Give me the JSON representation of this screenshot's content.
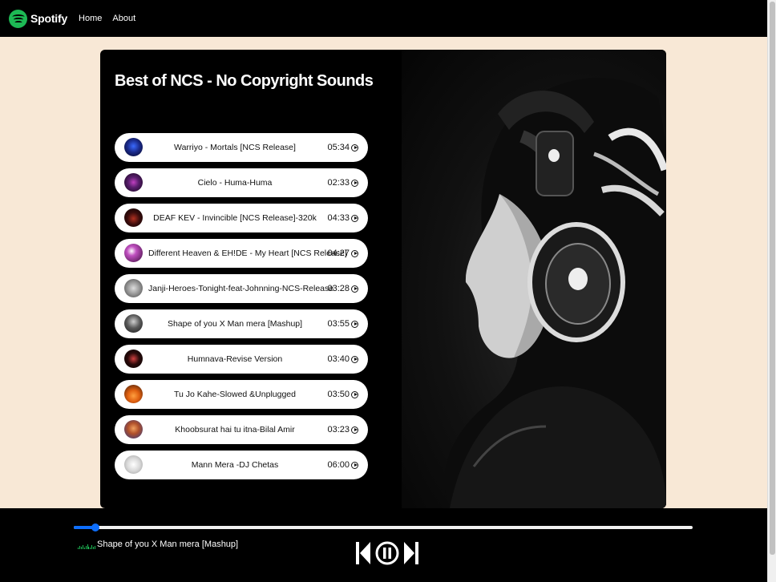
{
  "navbar": {
    "brand": "Spotify",
    "links": [
      "Home",
      "About"
    ],
    "brand_color": "#1db954"
  },
  "playlist": {
    "title": "Best of NCS - No Copyright Sounds",
    "songs": [
      {
        "name": "Warriyo - Mortals [NCS Release]",
        "duration": "05:34",
        "cover_color": "#1a2a8a"
      },
      {
        "name": "Cielo - Huma-Huma",
        "duration": "02:33",
        "cover_color": "#5a1e6e"
      },
      {
        "name": "DEAF KEV - Invincible [NCS Release]-320k",
        "duration": "04:33",
        "cover_color": "#3a0c0c"
      },
      {
        "name": "Different Heaven & EH!DE - My Heart [NCS Release]",
        "duration": "04:27",
        "cover_color": "#6a1a6a"
      },
      {
        "name": "Janji-Heroes-Tonight-feat-Johnning-NCS-Release",
        "duration": "03:28",
        "cover_color": "#9a9a9a"
      },
      {
        "name": "Shape of you X Man mera [Mashup]",
        "duration": "03:55",
        "cover_color": "#5a5a5a"
      },
      {
        "name": "Humnava-Revise Version",
        "duration": "03:40",
        "cover_color": "#2a0a0a"
      },
      {
        "name": "Tu Jo Kahe-Slowed &Unplugged",
        "duration": "03:50",
        "cover_color": "#e06010"
      },
      {
        "name": "Khoobsurat hai tu itna-Bilal Amir",
        "duration": "03:23",
        "cover_color": "#b0502a"
      },
      {
        "name": "Mann Mera -DJ Chetas",
        "duration": "06:00",
        "cover_color": "#d8d8d8"
      }
    ]
  },
  "player": {
    "now_playing": "Shape of you X Man mera [Mashup]",
    "progress": 0.035,
    "accent_color": "#0d6efd",
    "controls": [
      "previous-icon",
      "pause-icon",
      "next-icon"
    ]
  }
}
